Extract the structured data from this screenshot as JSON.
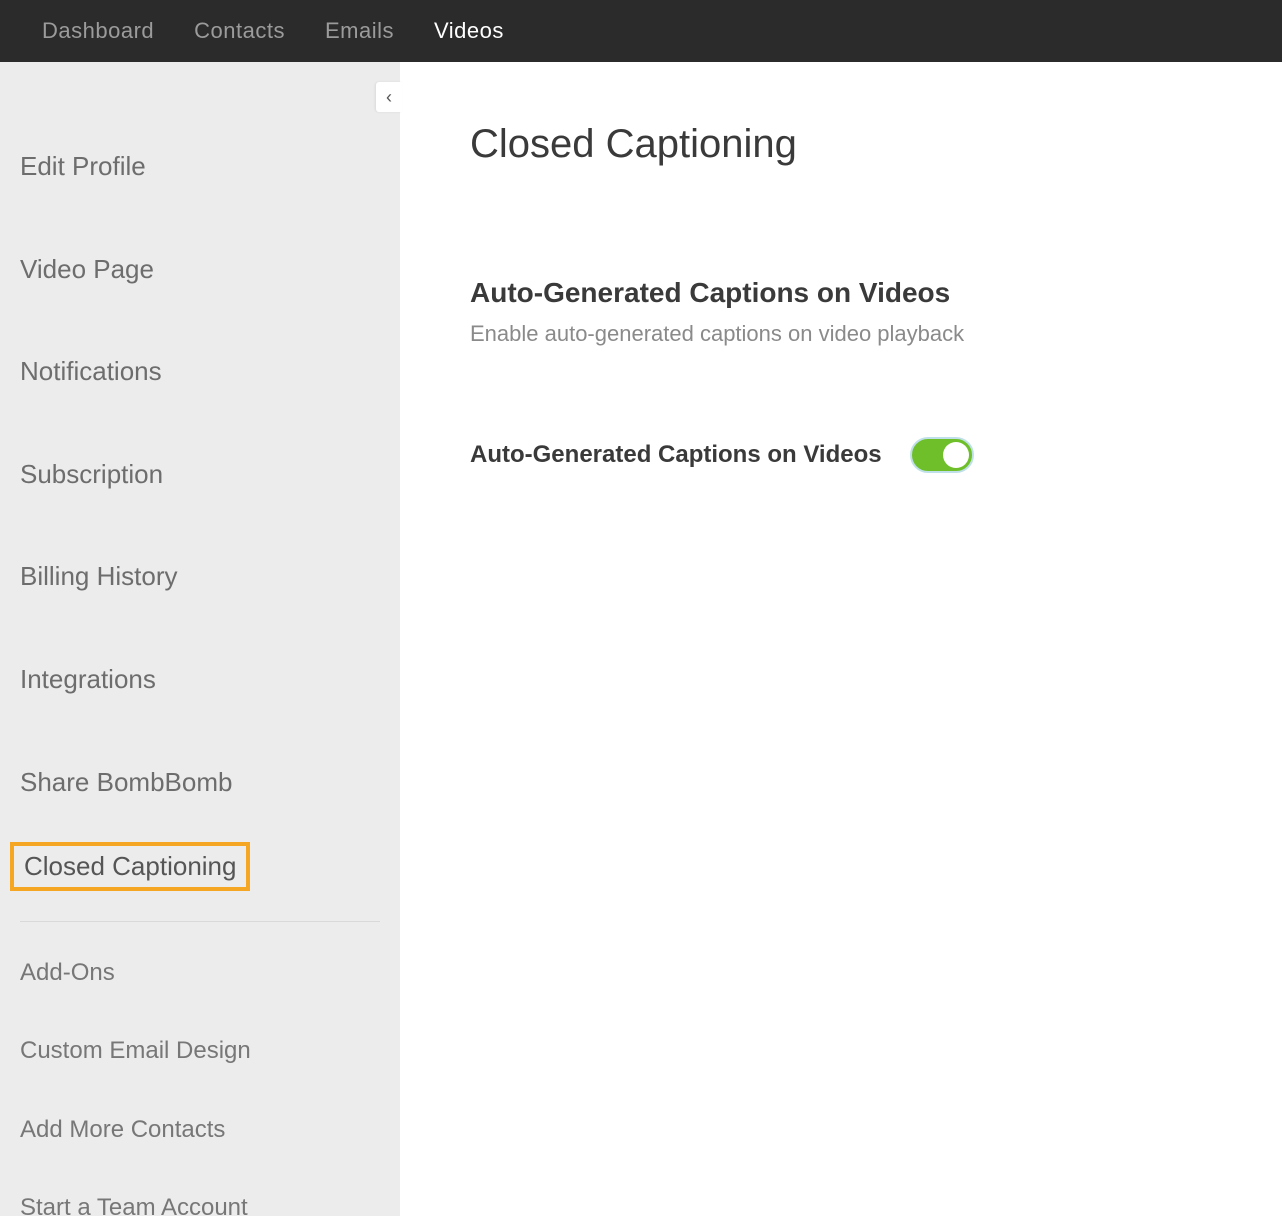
{
  "topnav": {
    "items": [
      {
        "label": "Dashboard"
      },
      {
        "label": "Contacts"
      },
      {
        "label": "Emails"
      },
      {
        "label": "Videos"
      }
    ],
    "active_index": 3
  },
  "sidebar": {
    "primary": [
      {
        "label": "Edit Profile"
      },
      {
        "label": "Video Page"
      },
      {
        "label": "Notifications"
      },
      {
        "label": "Subscription"
      },
      {
        "label": "Billing History"
      },
      {
        "label": "Integrations"
      },
      {
        "label": "Share BombBomb"
      },
      {
        "label": "Closed Captioning"
      }
    ],
    "highlight_index": 7,
    "secondary": [
      {
        "label": "Add-Ons"
      },
      {
        "label": "Custom Email Design"
      },
      {
        "label": "Add More Contacts"
      },
      {
        "label": "Start a Team Account"
      }
    ]
  },
  "main": {
    "page_title": "Closed Captioning",
    "section_title": "Auto-Generated Captions on Videos",
    "section_description": "Enable auto-generated captions on video playback",
    "toggle_label": "Auto-Generated Captions on Videos",
    "toggle_on": true
  },
  "annotation": {
    "arrow_color": "#f5a623"
  }
}
